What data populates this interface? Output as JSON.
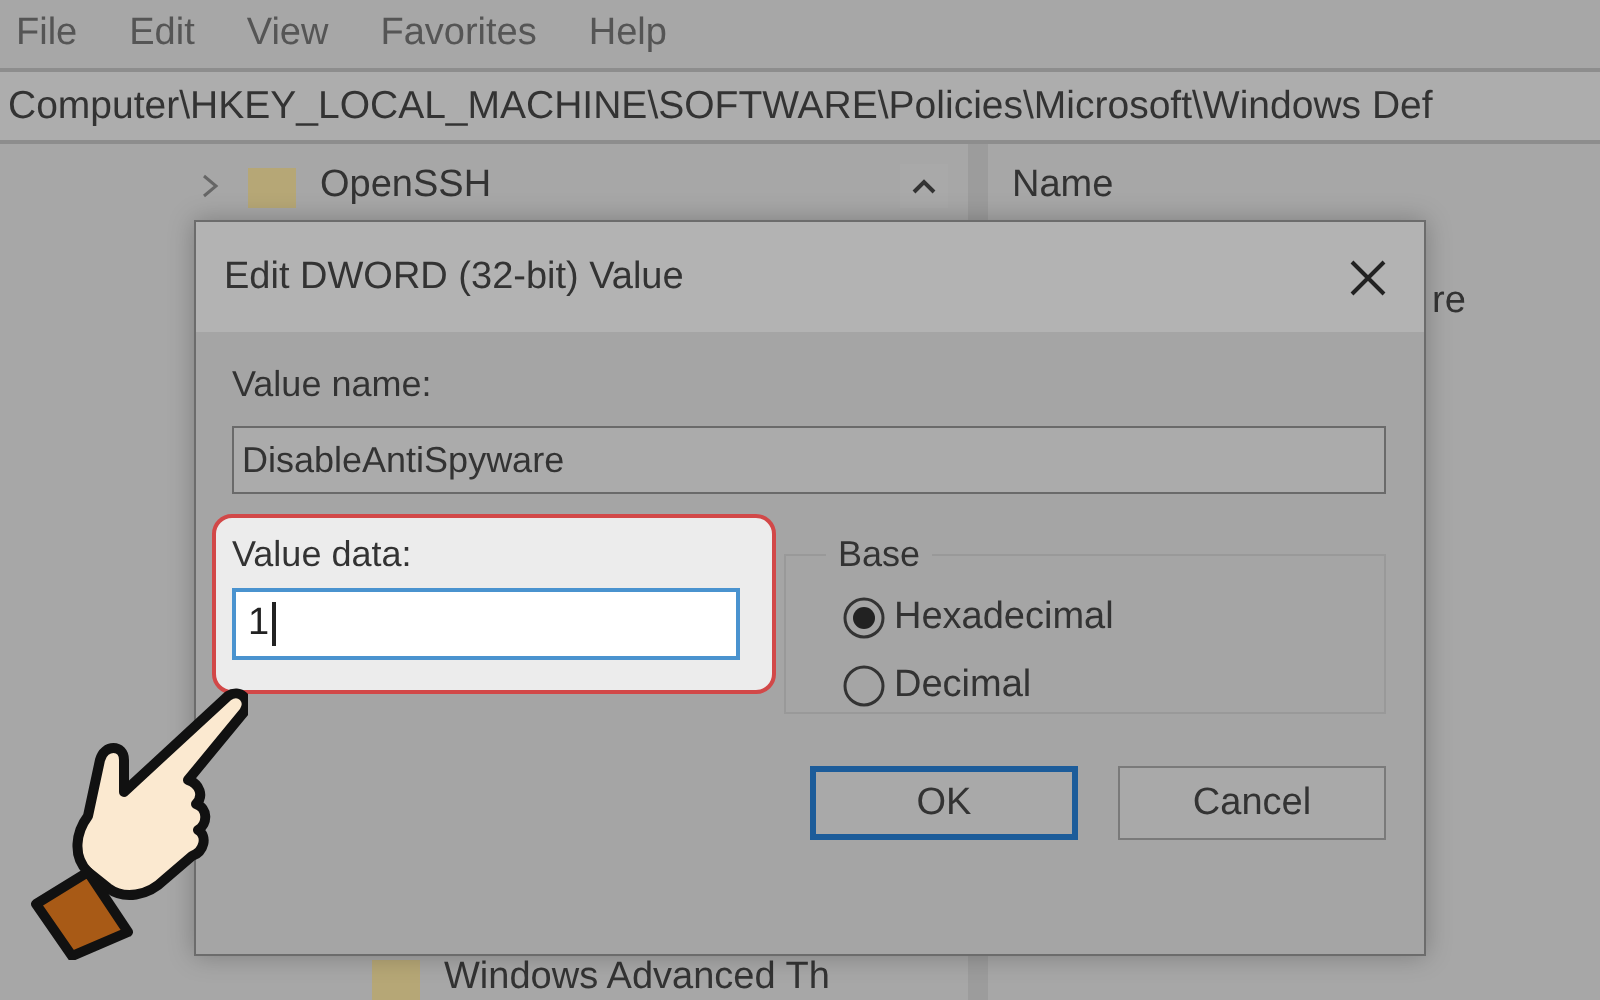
{
  "menu": [
    "File",
    "Edit",
    "View",
    "Favorites",
    "Help"
  ],
  "address": "Computer\\HKEY_LOCAL_MACHINE\\SOFTWARE\\Policies\\Microsoft\\Windows Def",
  "tree": {
    "items": [
      {
        "label": "OpenSSH",
        "expanded": false
      },
      {
        "label": "Windows Advanced Th",
        "expanded": false
      }
    ]
  },
  "list": {
    "columns": [
      "Name"
    ],
    "rows": [
      "re"
    ]
  },
  "dialog": {
    "title": "Edit DWORD (32-bit) Value",
    "value_name_label": "Value name:",
    "value_name": "DisableAntiSpyware",
    "value_data_label": "Value data:",
    "value_data": "1",
    "base_label": "Base",
    "base_options": [
      {
        "label": "Hexadecimal",
        "selected": true
      },
      {
        "label": "Decimal",
        "selected": false
      }
    ],
    "buttons": [
      {
        "label": "OK",
        "default": true
      },
      {
        "label": "Cancel",
        "default": false
      }
    ]
  }
}
